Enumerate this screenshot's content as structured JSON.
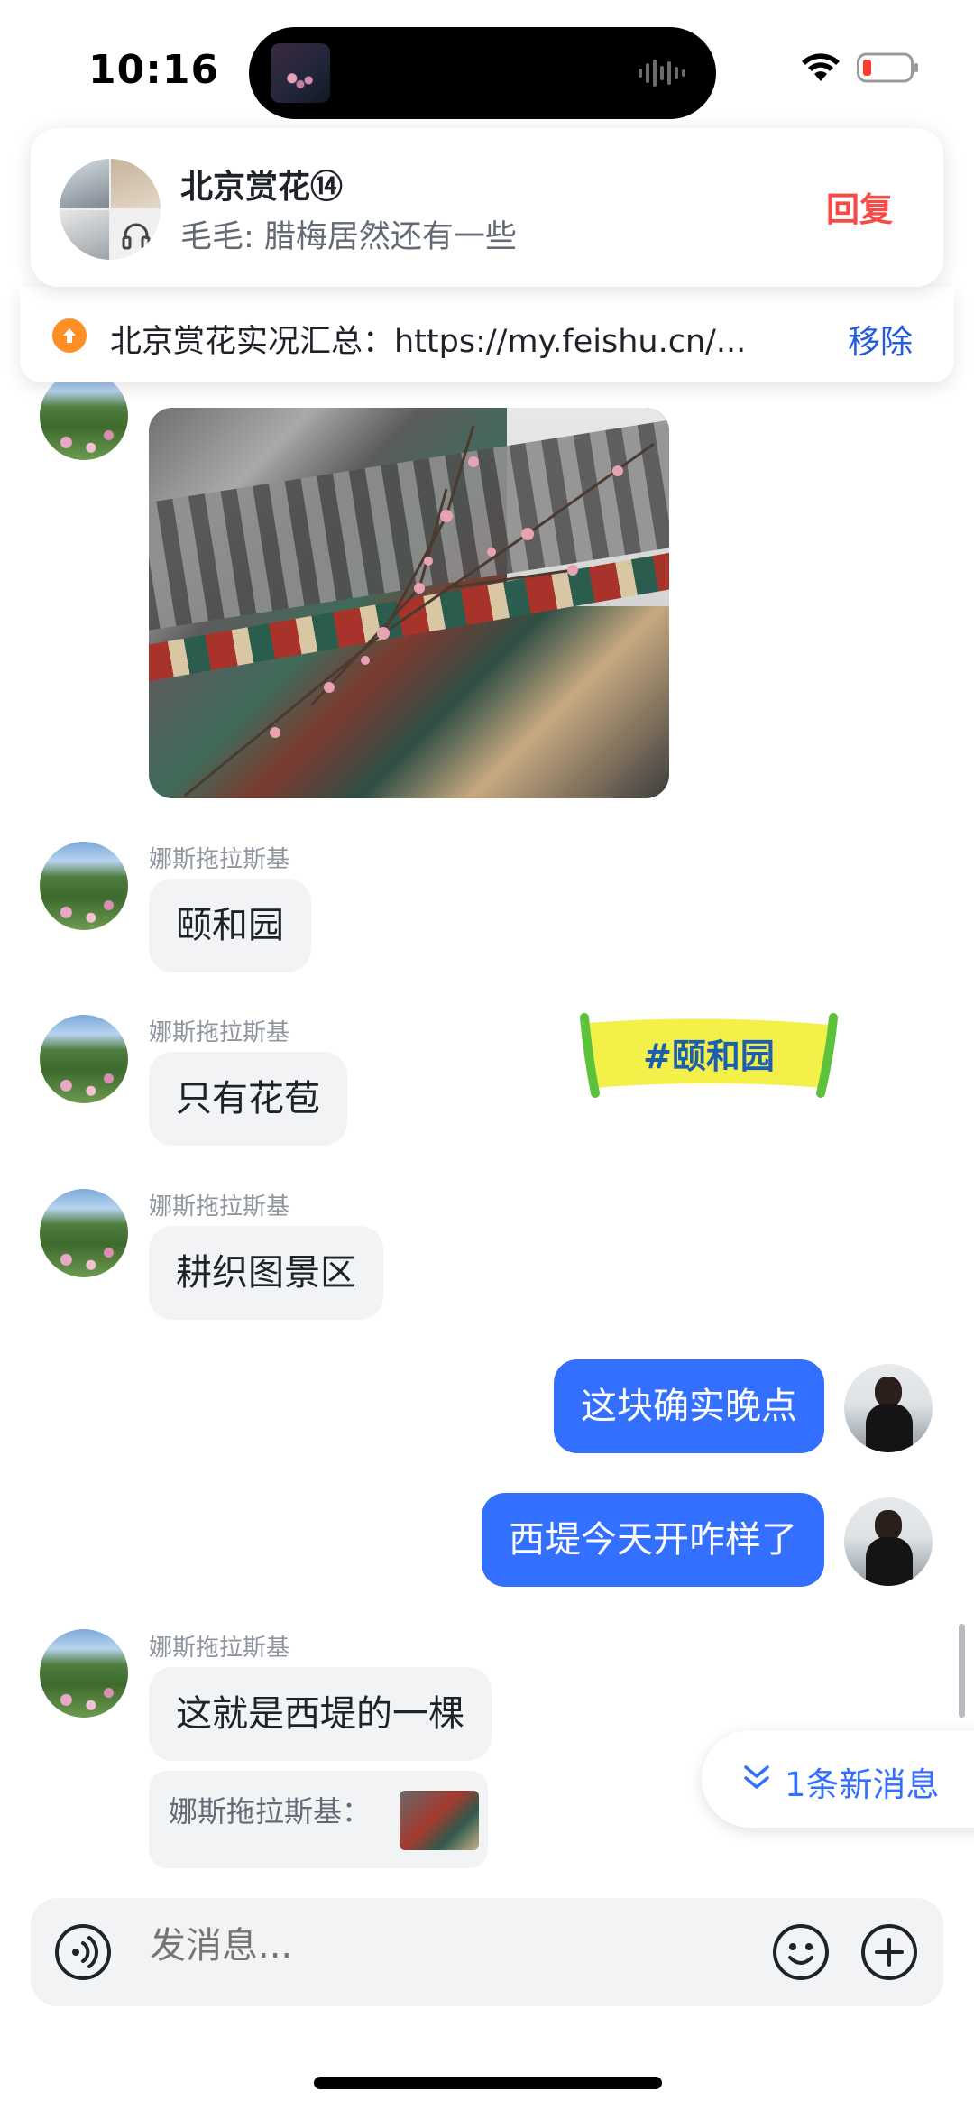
{
  "status_bar": {
    "time": "10:16"
  },
  "pinned_chat": {
    "title": "北京赏花⑭",
    "preview": "毛毛: 腊梅居然还有一些",
    "reply_label": "回复"
  },
  "pin_bar": {
    "text": "北京赏花实况汇总：https://my.feishu.cn/...",
    "remove_label": "移除"
  },
  "messages": [
    {
      "sender": "娜斯拖拉斯基",
      "type": "image"
    },
    {
      "sender": "娜斯拖拉斯基",
      "text": "颐和园"
    },
    {
      "sender": "娜斯拖拉斯基",
      "text": "只有花苞"
    },
    {
      "sender": "娜斯拖拉斯基",
      "text": "耕织图景区"
    },
    {
      "sender": "me",
      "text": "这块确实晚点"
    },
    {
      "sender": "me",
      "text": "西堤今天开咋样了"
    },
    {
      "sender": "娜斯拖拉斯基",
      "text": "这就是西堤的一棵"
    }
  ],
  "sticker": {
    "text": "#颐和园"
  },
  "quote": {
    "text": "娜斯拖拉斯基："
  },
  "new_messages": {
    "label": "1条新消息"
  },
  "composer": {
    "placeholder": "发消息..."
  },
  "colors": {
    "accent_blue": "#3370ff",
    "reply_red": "#f54a45",
    "pin_orange": "#ff8e25"
  },
  "icons": [
    "wifi-icon",
    "battery-icon",
    "voice-icon",
    "emoji-icon",
    "add-icon",
    "chevron-down-double-icon",
    "upload-icon",
    "headphone-icon"
  ]
}
